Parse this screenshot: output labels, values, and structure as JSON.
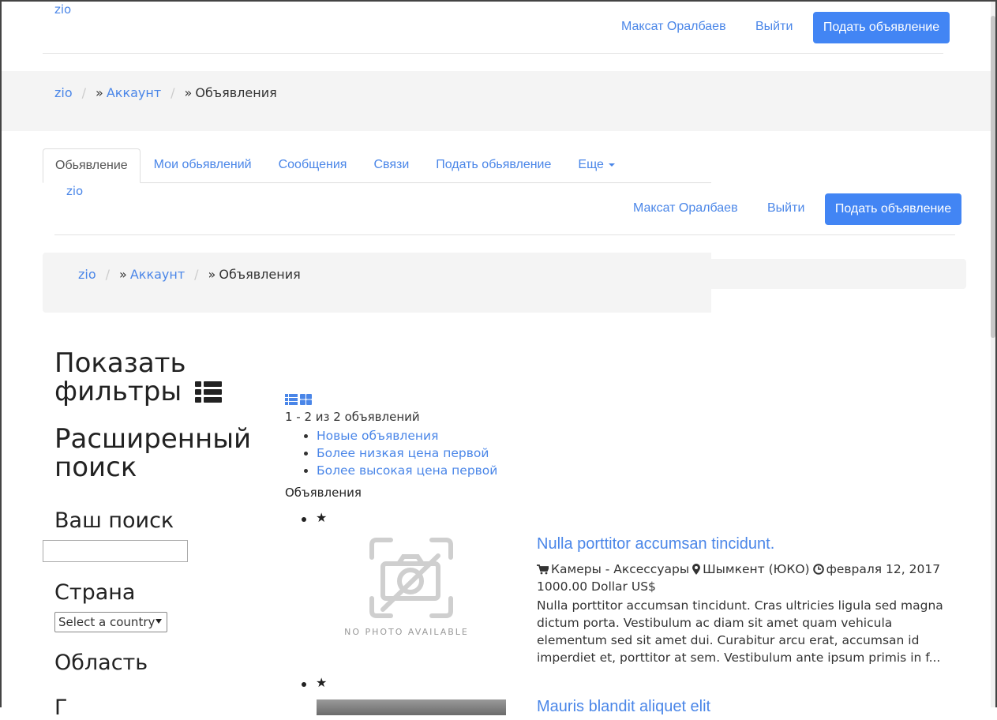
{
  "header": {
    "logo": "zio",
    "user": "Максат Оралбаев",
    "logout": "Выйти",
    "post_button": "Подать объявление"
  },
  "breadcrumb": {
    "home": "zio",
    "account": "Аккаунт",
    "current": "Объявления",
    "prefix": "»",
    "separator": "/"
  },
  "tabs": [
    {
      "label": "Обьявление"
    },
    {
      "label": "Мои обьявлений"
    },
    {
      "label": "Сообщения"
    },
    {
      "label": "Связи"
    },
    {
      "label": "Подать обьявление"
    },
    {
      "label": "Еще"
    }
  ],
  "sidebar": {
    "show_filters": "Показать фильтры",
    "advanced_search": "Расширенный поиск",
    "your_search": "Ваш поиск",
    "country_label": "Страна",
    "country_value": "Select a country",
    "region_label": "Область",
    "next_label": "Г"
  },
  "main": {
    "count_text": "1 - 2 из 2 объявлений",
    "sort_options": [
      "Новые объявления",
      "Более низкая цена первой",
      "Более высокая цена первой"
    ],
    "ads_heading": "Объявления",
    "ads": [
      {
        "title": "Nulla porttitor accumsan tincidunt.",
        "category": "Камеры - Аксессуары",
        "location": "Шымкент (ЮКО)",
        "date": "февраля 12, 2017",
        "price": "1000.00 Dollar US$",
        "description": "Nulla porttitor accumsan tincidunt. Cras ultricies ligula sed magna dictum porta. Vestibulum ac diam sit amet quam vehicula elementum sed sit amet dui. Curabitur arcu erat, accumsan id imperdiet et, porttitor at sem. Vestibulum ante ipsum primis in f...",
        "no_photo_text": "NO PHOTO AVAILABLE"
      },
      {
        "title": "Mauris blandit aliquet elit"
      }
    ]
  },
  "colors": {
    "link": "#4a86e8",
    "primary_button": "#4285f4",
    "breadcrumb_bg": "#f4f4f4"
  }
}
